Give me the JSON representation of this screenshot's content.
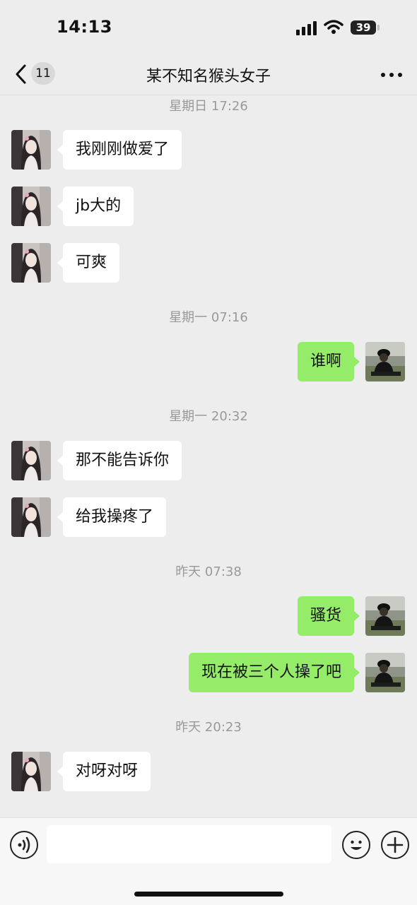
{
  "status_bar": {
    "time": "14:13",
    "battery": "39"
  },
  "nav": {
    "unread_count": "11",
    "title": "某不知名猴头女子"
  },
  "messages": [
    {
      "type": "time",
      "text": "星期日 17:26"
    },
    {
      "type": "in",
      "text": "我刚刚做爱了"
    },
    {
      "type": "in",
      "text": "jb大的"
    },
    {
      "type": "in",
      "text": "可爽"
    },
    {
      "type": "time",
      "text": "星期一 07:16"
    },
    {
      "type": "out",
      "text": "谁啊"
    },
    {
      "type": "time",
      "text": "星期一 20:32"
    },
    {
      "type": "in",
      "text": "那不能告诉你"
    },
    {
      "type": "in",
      "text": "给我操疼了"
    },
    {
      "type": "time",
      "text": "昨天 07:38"
    },
    {
      "type": "out",
      "text": "骚货"
    },
    {
      "type": "out",
      "text": "现在被三个人操了吧"
    },
    {
      "type": "time",
      "text": "昨天 20:23"
    },
    {
      "type": "in",
      "text": "对呀对呀"
    }
  ],
  "input": {
    "value": "",
    "placeholder": ""
  },
  "icons": {
    "back": "chevron-left-icon",
    "more": "more-dots-icon",
    "voice": "voice-icon",
    "emoji": "emoji-icon",
    "plus": "plus-icon",
    "signal": "signal-icon",
    "wifi": "wifi-icon",
    "battery": "battery-icon"
  },
  "colors": {
    "background": "#ededed",
    "incoming_bubble": "#ffffff",
    "outgoing_bubble": "#95ec69",
    "timestamp": "#999999"
  }
}
